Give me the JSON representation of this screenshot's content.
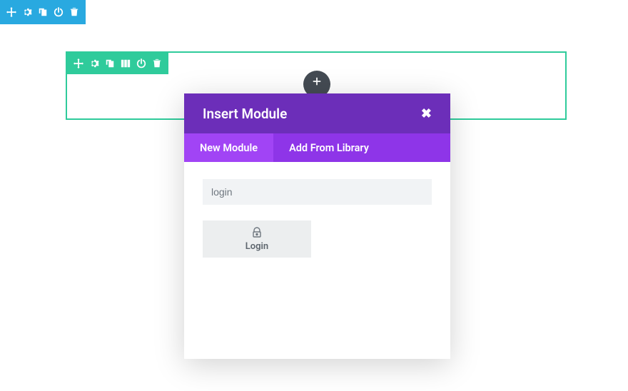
{
  "section_toolbar": {
    "items": [
      {
        "name": "move-icon"
      },
      {
        "name": "gear-icon"
      },
      {
        "name": "duplicate-icon"
      },
      {
        "name": "power-icon"
      },
      {
        "name": "trash-icon"
      }
    ]
  },
  "row_toolbar": {
    "items": [
      {
        "name": "move-icon"
      },
      {
        "name": "gear-icon"
      },
      {
        "name": "duplicate-icon"
      },
      {
        "name": "columns-icon"
      },
      {
        "name": "power-icon"
      },
      {
        "name": "trash-icon"
      }
    ]
  },
  "add_button": {
    "name": "plus-icon"
  },
  "modal": {
    "title": "Insert Module",
    "tabs": {
      "new_module": "New Module",
      "add_from_library": "Add From Library"
    },
    "search_value": "login",
    "results": [
      {
        "icon": "lock-icon",
        "label": "Login"
      }
    ]
  }
}
